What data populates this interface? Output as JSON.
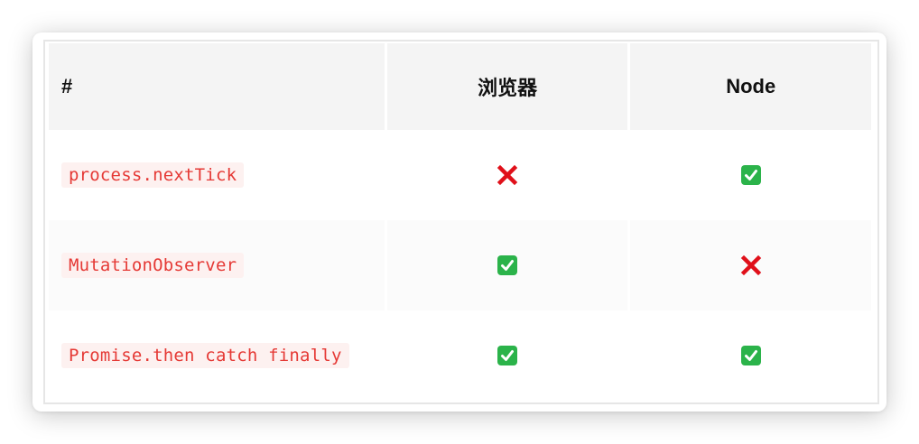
{
  "table": {
    "headers": [
      "#",
      "浏览器",
      "Node"
    ],
    "rows": [
      {
        "api": "process.nextTick",
        "browser": "cross-icon",
        "node": "check-icon"
      },
      {
        "api": "MutationObserver",
        "browser": "check-icon",
        "node": "cross-icon"
      },
      {
        "api": "Promise.then catch finally",
        "browser": "check-icon",
        "node": "check-icon"
      }
    ]
  },
  "colors": {
    "check_green": "#2bb34a",
    "cross_red": "#e0101a",
    "code_text": "#e53935",
    "code_bg": "#fdf1f0",
    "header_bg": "#f4f4f4"
  }
}
